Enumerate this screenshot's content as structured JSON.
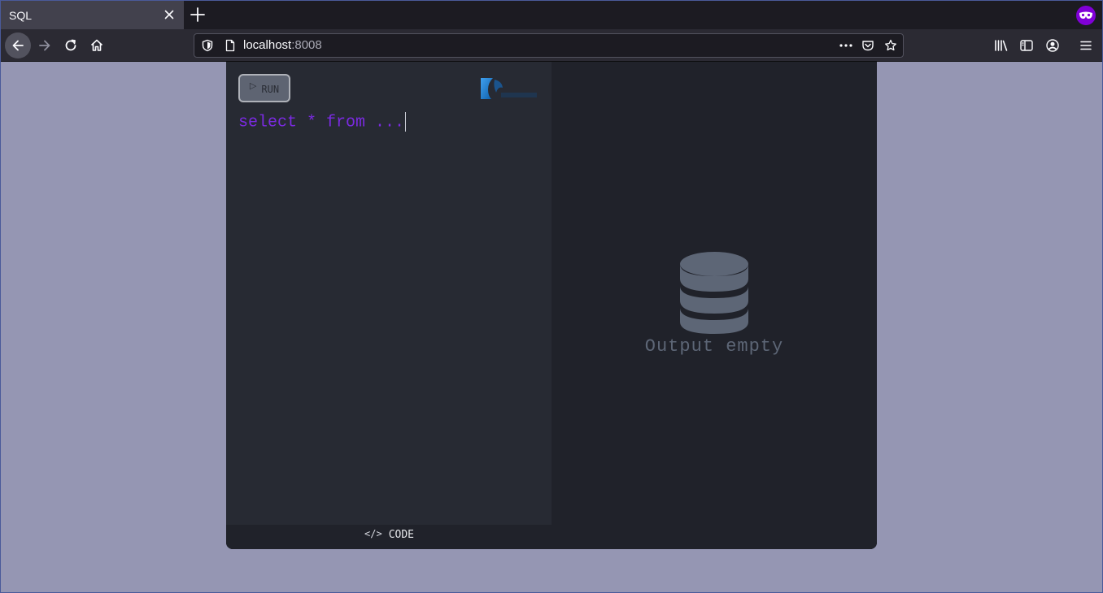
{
  "browser": {
    "tab": {
      "title": "SQL"
    },
    "url": {
      "host": "localhost",
      "port": ":8008"
    }
  },
  "icons": {
    "tab_close": "close-icon",
    "new_tab": "plus-icon",
    "private": "private-browsing-icon",
    "back": "arrow-left-icon",
    "forward": "arrow-right-icon",
    "reload": "reload-icon",
    "home": "home-icon",
    "library": "library-icon",
    "sidebar": "sidebar-icon",
    "account": "account-icon",
    "menu": "hamburger-menu-icon",
    "database": "database-icon"
  },
  "app": {
    "run_label": "RUN",
    "run_icon": "▷",
    "code_text": "select * from ...",
    "output_empty": "Output empty",
    "footer_icon": "</>",
    "footer_label": "CODE"
  },
  "colors": {
    "page_bg": "#9596b3",
    "editor_bg": "#272a33",
    "output_bg": "#20222a",
    "code_text": "#7a2ae0",
    "muted_icon": "#5d6676"
  }
}
